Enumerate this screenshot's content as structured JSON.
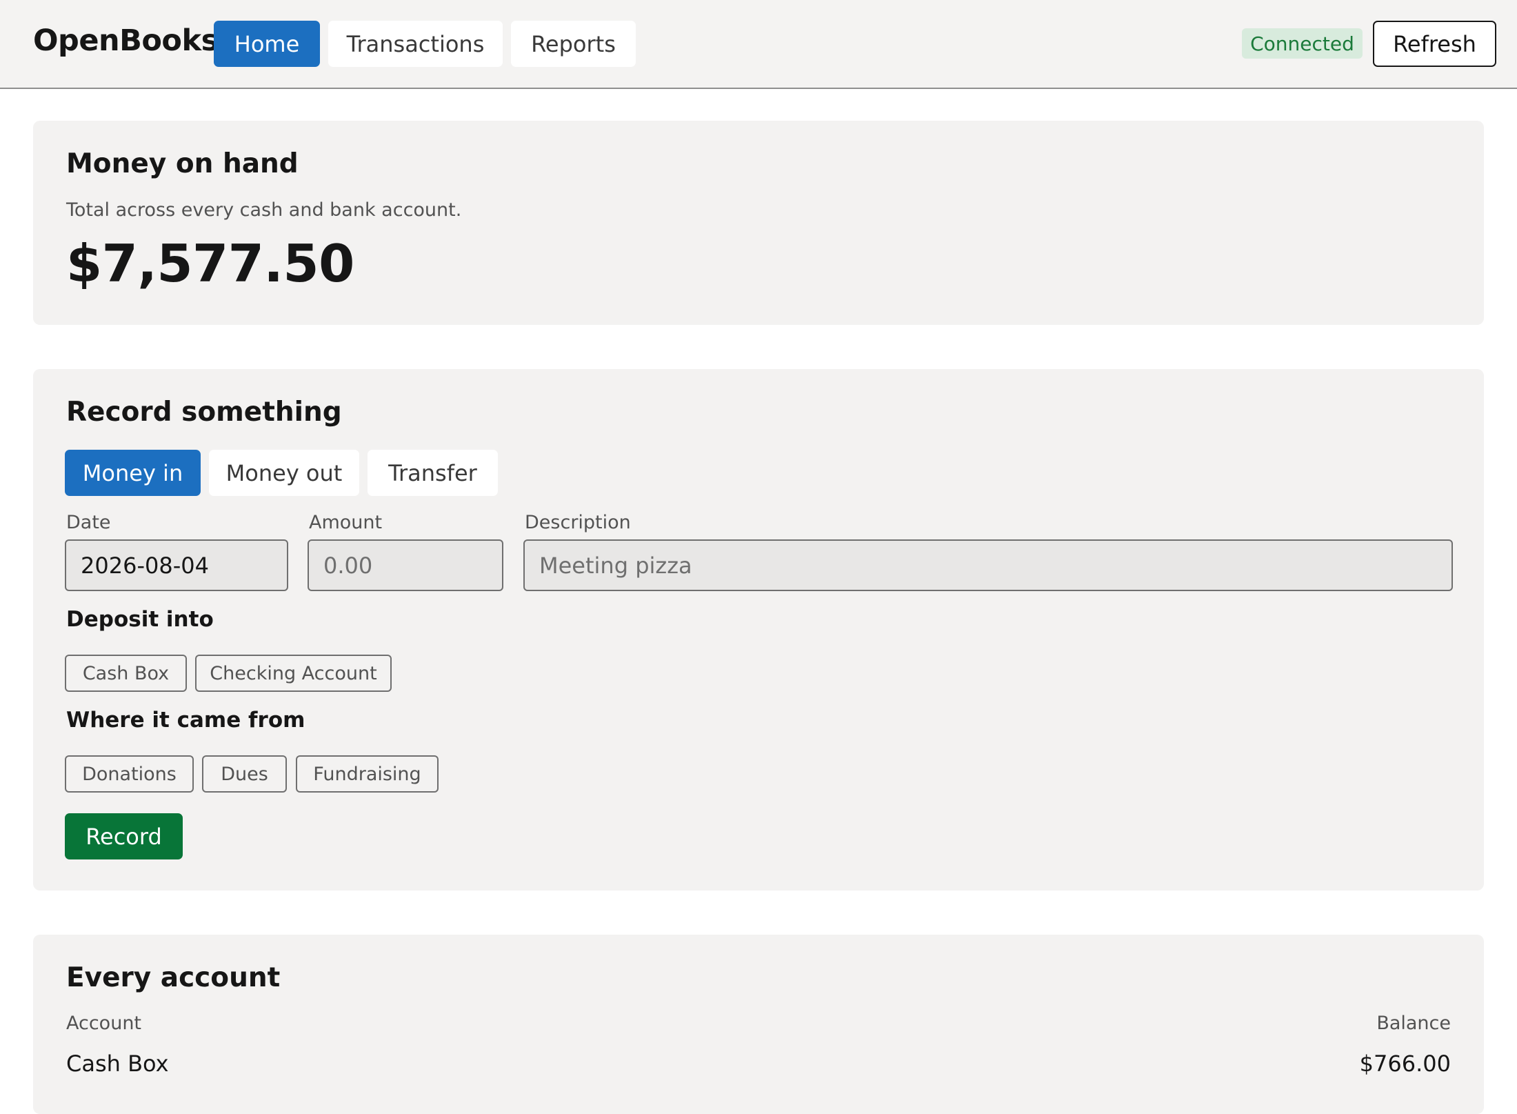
{
  "header": {
    "brand": "OpenBooks",
    "nav": [
      {
        "label": "Home",
        "active": true
      },
      {
        "label": "Transactions",
        "active": false
      },
      {
        "label": "Reports",
        "active": false
      }
    ],
    "status": "Connected",
    "refresh_label": "Refresh"
  },
  "summary": {
    "title": "Money on hand",
    "subtitle": "Total across every cash and bank account.",
    "total": "$7,577.50"
  },
  "record": {
    "title": "Record something",
    "tabs": [
      {
        "label": "Money in",
        "active": true
      },
      {
        "label": "Money out",
        "active": false
      },
      {
        "label": "Transfer",
        "active": false
      }
    ],
    "date": {
      "label": "Date",
      "value": "2026-08-04"
    },
    "amount": {
      "label": "Amount",
      "placeholder": "0.00"
    },
    "description": {
      "label": "Description",
      "placeholder": "Meeting pizza"
    },
    "deposit_label": "Deposit into",
    "deposit_options": [
      "Cash Box",
      "Checking Account"
    ],
    "source_label": "Where it came from",
    "source_options": [
      "Donations",
      "Dues",
      "Fundraising"
    ],
    "submit_label": "Record"
  },
  "accounts": {
    "title": "Every account",
    "columns": [
      "Account",
      "Balance"
    ],
    "rows": [
      {
        "account": "Cash Box",
        "balance": "$766.00"
      }
    ]
  },
  "colors": {
    "accent": "#1c6fc0",
    "success": "#087538",
    "status_bg": "#d8ebdd",
    "status_text": "#1b7a3a",
    "card_bg": "#f3f2f1"
  }
}
